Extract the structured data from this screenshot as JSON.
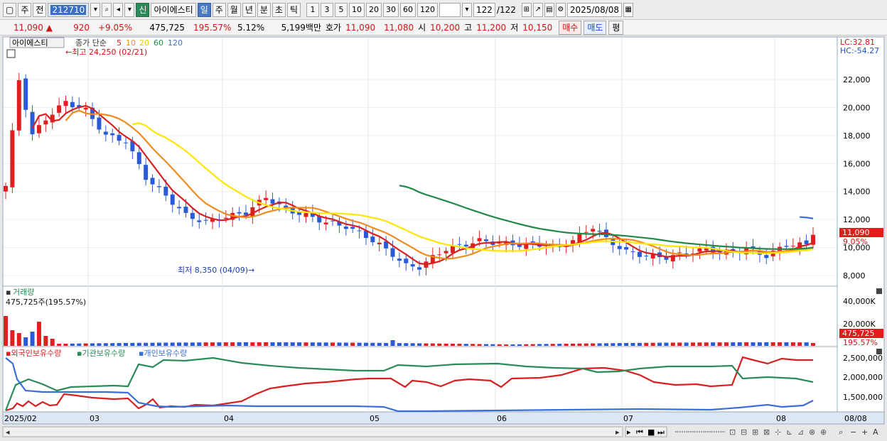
{
  "toolbar": {
    "market": "주",
    "prev": "전",
    "stock_code": "212710",
    "new_badge": "신",
    "stock_name": "아이에스티",
    "period_tabs": [
      "일",
      "주",
      "월",
      "년",
      "분",
      "초",
      "틱"
    ],
    "interval_buttons": [
      "1",
      "3",
      "5",
      "10",
      "20",
      "30",
      "60",
      "120"
    ],
    "count_display": "122",
    "count_total": "/122",
    "date": "2025/08/08"
  },
  "info": {
    "price": "11,090",
    "change": "920",
    "change_pct": "+9.05%",
    "volume": "475,725",
    "volume_ratio": "195.57%",
    "turnover": "5.12%",
    "amount": "5,199백만",
    "ask_label": "호가",
    "ask": "11,090",
    "bid": "11,080",
    "open_label": "시",
    "open": "10,200",
    "high_label": "고",
    "high": "11,200",
    "low_label": "저",
    "low": "10,150",
    "buy_label": "매수",
    "sell_label": "매도",
    "eval_label": "평"
  },
  "price_pane": {
    "stock_tag": "아이에스티",
    "legend_prefix": "종가 단순",
    "ma_periods": [
      "5",
      "10",
      "20",
      "60",
      "120"
    ],
    "ma_colors": [
      "#d82020",
      "#f08c1c",
      "#ffe600",
      "#22884a",
      "#3a6ed8"
    ],
    "high_annotation": "최고 24,250 (02/21)",
    "low_annotation": "최저 8,350 (04/09)",
    "lc_label": "LC:32.81",
    "hc_label": "HC:-54.27",
    "price_ticks": [
      "22,000",
      "20,000",
      "18,000",
      "16,000",
      "14,000",
      "12,000",
      "10,000",
      "8,000"
    ],
    "current_price_tag": "11,090",
    "current_pct_tag": "9.05%"
  },
  "volume_pane": {
    "title": "거래량",
    "value_label": "475,725주(195.57%)",
    "ticks": [
      "40,000K",
      "20,000K"
    ],
    "current_tag": "475,725",
    "current_pct": "195.57%"
  },
  "holdings_pane": {
    "legend": [
      "외국인보유수량",
      "기관보유수량",
      "개인보유수량"
    ],
    "colors": [
      "#d82020",
      "#2a8a5a",
      "#3a6ed8"
    ],
    "ticks": [
      "2,500,000",
      "2,000,000",
      "1,500,000"
    ]
  },
  "x_axis": {
    "labels": [
      "2025/02",
      "03",
      "04",
      "05",
      "06",
      "07",
      "08"
    ],
    "right_label": "08/08"
  }
}
